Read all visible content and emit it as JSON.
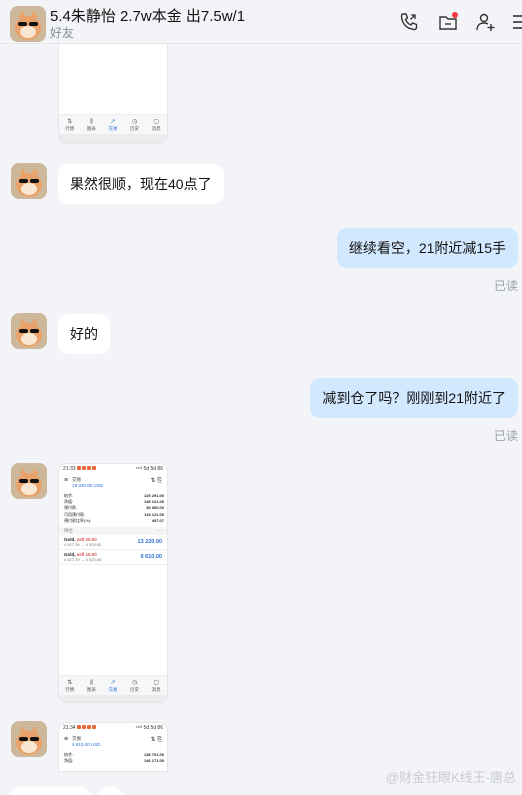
{
  "header": {
    "title": "5.4朱静怡 2.7w本金 出7.5w/1",
    "subtitle": "好友"
  },
  "messages": [
    {
      "text": "果然很顺，现在40点了"
    },
    {
      "text": "继续看空，21附近减15手",
      "status": "已读"
    },
    {
      "text": "好的"
    },
    {
      "text": "减到仓了吗？刚刚到21附近了",
      "status": "已读"
    }
  ],
  "shot_nav": [
    "行情",
    "图表",
    "交易",
    "历史",
    "消息"
  ],
  "shot2": {
    "time": "21:33",
    "battery": "⁵⁶ᴳ 5d 5d 86",
    "label": "交易",
    "balance": "19 330.00 USD",
    "rows": [
      {
        "k": "结余:",
        "v": "125 291.00"
      },
      {
        "k": "净值:",
        "v": "149 121.00"
      },
      {
        "k": "预付款:",
        "v": "30 000.00"
      },
      {
        "k": "可用预付款:",
        "v": "119 121.00"
      },
      {
        "k": "预付款比率(%):",
        "v": "497.07"
      }
    ],
    "section": "持仓",
    "section_more": "···",
    "positions": [
      {
        "sym": "Gold,",
        "side": "sell 20.00",
        "px": "4 527.39 → 4 520.65",
        "pl": "13 220.00"
      },
      {
        "sym": "Gold,",
        "side": "sell 10.00",
        "px": "4 527.39 → 4 520.65",
        "pl": "6 610.00"
      }
    ]
  },
  "shot3": {
    "time": "21:34",
    "label": "交易",
    "balance": "6 610.00 USD",
    "rows": [
      {
        "k": "结余:",
        "v": "138 701.00"
      },
      {
        "k": "净值:",
        "v": "146 171.00"
      }
    ]
  },
  "watermark": "@财金狂眼K线王-唐总",
  "colors": {
    "bubble_out": "#d2e8ff",
    "bubble_in": "#ffffff",
    "accent": "#2a6fd6",
    "sell": "#d9534f"
  }
}
